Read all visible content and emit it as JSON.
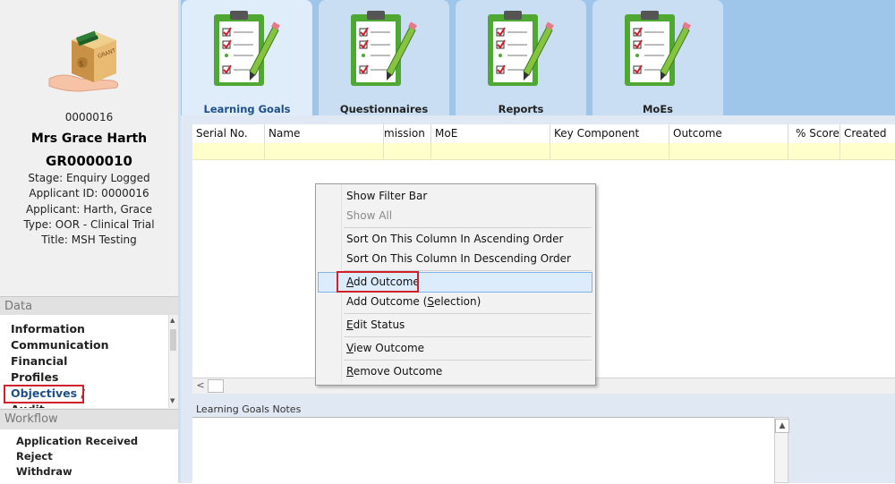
{
  "profile": {
    "id": "0000016",
    "name": "Mrs Grace Harth",
    "ref": "GR0000010",
    "stage": "Stage: Enquiry Logged",
    "applicant_id": "Applicant ID: 0000016",
    "applicant": "Applicant: Harth, Grace",
    "type": "Type: OOR - Clinical Trial",
    "title": "Title: MSH Testing"
  },
  "data_section": {
    "header": "Data",
    "items": [
      "Information",
      "Communication",
      "Financial",
      "Profiles",
      "Objectives /",
      "Audit"
    ]
  },
  "workflow_section": {
    "header": "Workflow",
    "items": [
      "Application Received",
      "Reject",
      "Withdraw"
    ]
  },
  "tabs": [
    {
      "label": "Learning Goals",
      "active": true
    },
    {
      "label": "Questionnaires",
      "active": false
    },
    {
      "label": "Reports",
      "active": false
    },
    {
      "label": "MoEs",
      "active": false
    }
  ],
  "grid": {
    "columns": [
      "Serial No.",
      "Name",
      "mission",
      "MoE",
      "Key Component",
      "Outcome",
      "% Score",
      "Created"
    ]
  },
  "notes": {
    "label": "Learning Goals Notes"
  },
  "context_menu": {
    "show_filter_bar": "Show Filter Bar",
    "show_all": "Show All",
    "sort_asc": "Sort On This Column In Ascending Order",
    "sort_desc": "Sort On This Column In Descending Order",
    "add_outcome_a": "A",
    "add_outcome_b": "dd Outcome",
    "add_outcome_sel_a": "Add Outcome (",
    "add_outcome_sel_b": "S",
    "add_outcome_sel_c": "election)",
    "edit_status_a": "E",
    "edit_status_b": "dit Status",
    "view_outcome_a": "V",
    "view_outcome_b": "iew Outcome",
    "remove_outcome_a": "R",
    "remove_outcome_b": "emove Outcome"
  },
  "colors": {
    "highlight_border": "#d0202a",
    "tab_active_text": "#1f4f8b",
    "filter_row": "#ffffcc"
  }
}
